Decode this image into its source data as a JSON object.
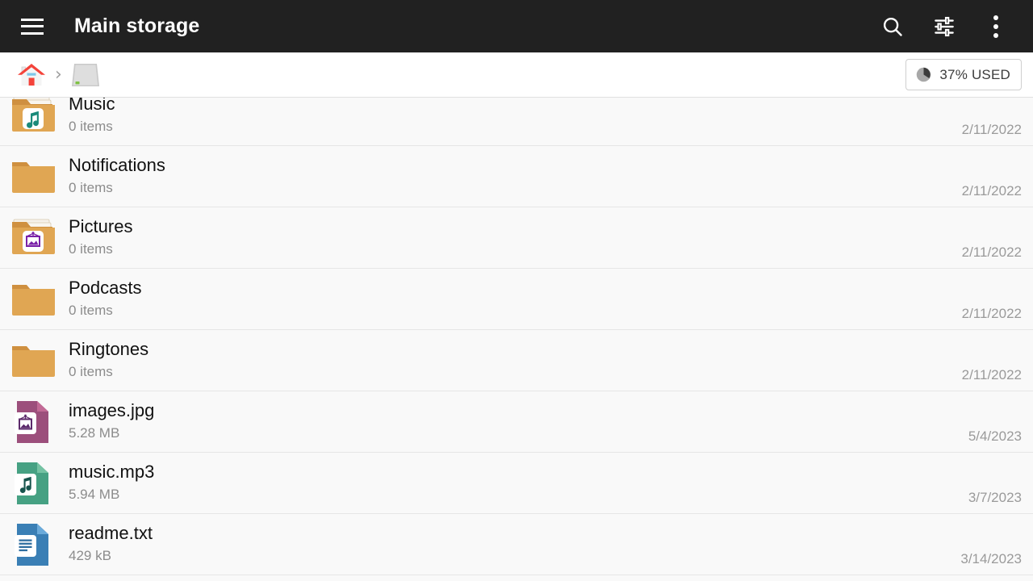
{
  "appbar": {
    "menu_icon": "hamburger-menu-icon",
    "title": "Main storage",
    "search_icon": "search-icon",
    "filter_icon": "sliders-settings-icon",
    "overflow_icon": "overflow-menu-icon"
  },
  "breadcrumb": {
    "home_icon": "home-icon",
    "separator": "›",
    "drive_icon": "hard-drive-icon",
    "usage": {
      "pie_icon": "pie-chart-icon",
      "label": "37% USED",
      "percent": 37
    }
  },
  "list": {
    "rows": [
      {
        "name": "Music",
        "sub": "0 items",
        "date": "2/11/2022",
        "icon": "folder-music-icon"
      },
      {
        "name": "Notifications",
        "sub": "0 items",
        "date": "2/11/2022",
        "icon": "folder-icon"
      },
      {
        "name": "Pictures",
        "sub": "0 items",
        "date": "2/11/2022",
        "icon": "folder-pictures-icon"
      },
      {
        "name": "Podcasts",
        "sub": "0 items",
        "date": "2/11/2022",
        "icon": "folder-icon"
      },
      {
        "name": "Ringtones",
        "sub": "0 items",
        "date": "2/11/2022",
        "icon": "folder-icon"
      },
      {
        "name": "images.jpg",
        "sub": "5.28 MB",
        "date": "5/4/2023",
        "icon": "file-image-icon"
      },
      {
        "name": "music.mp3",
        "sub": "5.94 MB",
        "date": "3/7/2023",
        "icon": "file-audio-icon"
      },
      {
        "name": "readme.txt",
        "sub": "429 kB",
        "date": "3/14/2023",
        "icon": "file-text-icon"
      }
    ]
  },
  "colors": {
    "appbar_bg": "#212121",
    "list_bg": "#f9f9f9",
    "folder": "#e0a653",
    "folder_tab": "#cf9040",
    "music_accent": "#1a8a7a",
    "picture_accent": "#7b21a8",
    "file_image": "#9c4f7c",
    "file_audio": "#46a183",
    "file_text": "#3a7fb5",
    "home_roof": "#f4433a"
  }
}
